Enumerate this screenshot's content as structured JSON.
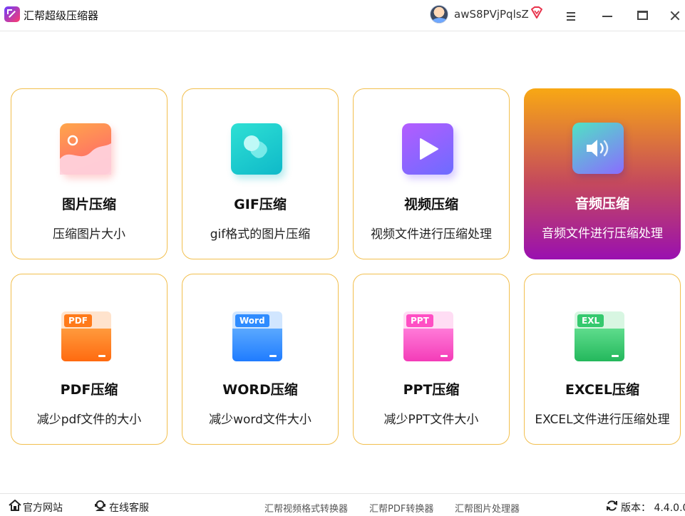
{
  "app": {
    "title": "汇帮超级压缩器",
    "username": "awS8PVjPqlsZ"
  },
  "cards": [
    {
      "title": "图片压缩",
      "desc": "压缩图片大小"
    },
    {
      "title": "GIF压缩",
      "desc": "gif格式的图片压缩"
    },
    {
      "title": "视频压缩",
      "desc": "视频文件进行压缩处理"
    },
    {
      "title": "音频压缩",
      "desc": "音频文件进行压缩处理"
    },
    {
      "title": "PDF压缩",
      "desc": "减少pdf文件的大小",
      "badge": "PDF"
    },
    {
      "title": "WORD压缩",
      "desc": "减少word文件大小",
      "badge": "Word"
    },
    {
      "title": "PPT压缩",
      "desc": "减少PPT文件大小",
      "badge": "PPT"
    },
    {
      "title": "EXCEL压缩",
      "desc": "EXCEL文件进行压缩处理",
      "badge": "EXL"
    }
  ],
  "footer": {
    "website": "官方网站",
    "service": "在线客服",
    "links": [
      "汇帮视频格式转换器",
      "汇帮PDF转换器",
      "汇帮图片处理器"
    ],
    "version": "版本：  4.4.0.0"
  },
  "colors": {
    "card_border": "#f2bf4e",
    "active_gradient_top": "#f8a814",
    "active_gradient_bottom": "#9a10b0",
    "pdf": "#ff7a1a",
    "word": "#2f8cff",
    "ppt": "#ff4fc4",
    "excel": "#35c96e"
  }
}
